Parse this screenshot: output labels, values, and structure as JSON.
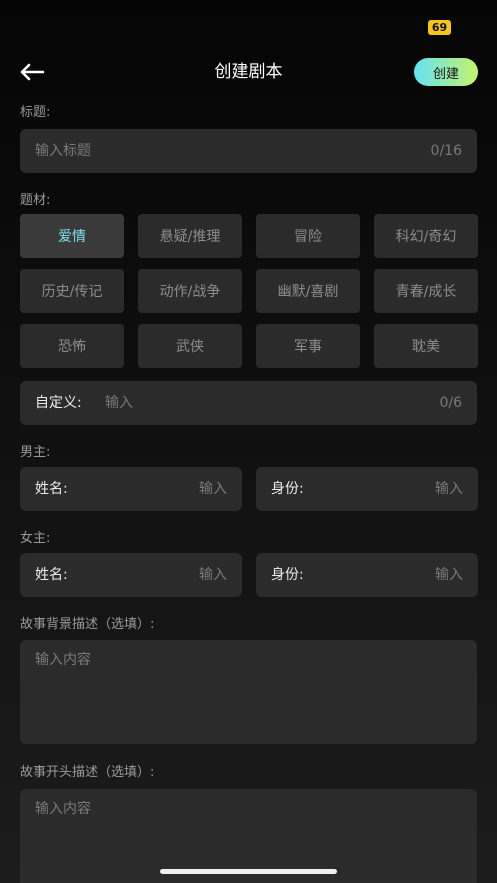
{
  "status_bar": {
    "battery": "69"
  },
  "header": {
    "title": "创建剧本",
    "create_label": "创建"
  },
  "title_section": {
    "label": "标题:",
    "placeholder": "输入标题",
    "counter": "0/16"
  },
  "genre_section": {
    "label": "题材:",
    "tags": [
      {
        "label": "爱情",
        "selected": true
      },
      {
        "label": "悬疑/推理",
        "selected": false
      },
      {
        "label": "冒险",
        "selected": false
      },
      {
        "label": "科幻/奇幻",
        "selected": false
      },
      {
        "label": "历史/传记",
        "selected": false
      },
      {
        "label": "动作/战争",
        "selected": false
      },
      {
        "label": "幽默/喜剧",
        "selected": false
      },
      {
        "label": "青春/成长",
        "selected": false
      },
      {
        "label": "恐怖",
        "selected": false
      },
      {
        "label": "武侠",
        "selected": false
      },
      {
        "label": "军事",
        "selected": false
      },
      {
        "label": "耽美",
        "selected": false
      }
    ],
    "custom": {
      "label": "自定义:",
      "placeholder": "输入",
      "counter": "0/6"
    }
  },
  "male_lead": {
    "label": "男主:",
    "name_label": "姓名:",
    "name_placeholder": "输入",
    "identity_label": "身份:",
    "identity_placeholder": "输入"
  },
  "female_lead": {
    "label": "女主:",
    "name_label": "姓名:",
    "name_placeholder": "输入",
    "identity_label": "身份:",
    "identity_placeholder": "输入"
  },
  "background": {
    "label": "故事背景描述（选填）:",
    "placeholder": "输入内容"
  },
  "opening": {
    "label": "故事开头描述（选填）:",
    "placeholder": "输入内容"
  },
  "colors": {
    "accent_gradient_start": "#62e5f4",
    "accent_gradient_end": "#c6f26c",
    "selected_tag_text": "#7ee2ef",
    "battery_badge": "#f5c518"
  },
  "icons": {
    "back": "arrow-left-icon"
  }
}
